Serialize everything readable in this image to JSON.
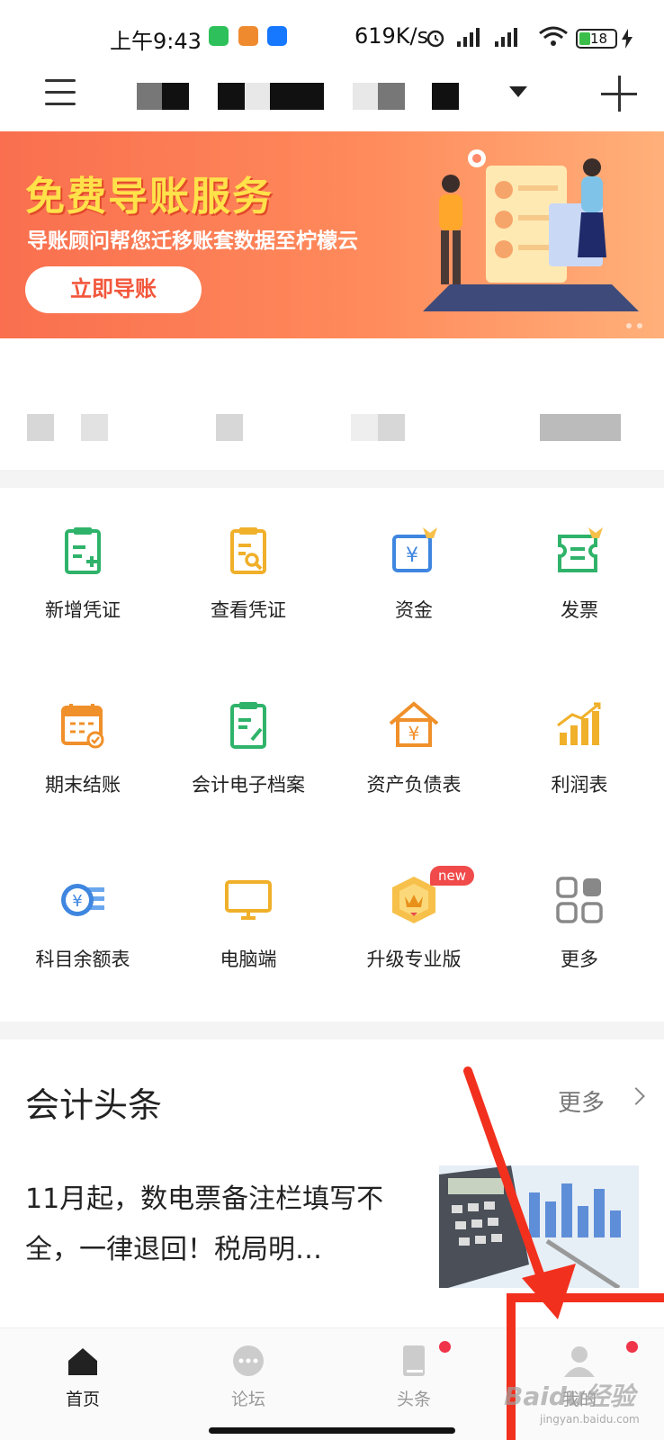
{
  "status_bar": {
    "time": "上午9:43",
    "net_speed": "619K/s",
    "battery": "18"
  },
  "nav": {
    "menu_icon": "menu-icon",
    "add_icon": "plus-icon",
    "org_name_redacted": true
  },
  "banner": {
    "title": "免费导账服务",
    "subtitle": "导账顾问帮您迁移账套数据至柠檬云",
    "button_label": "立即导账"
  },
  "grid": {
    "items": [
      {
        "label": "新增凭证",
        "icon": "add-voucher-icon"
      },
      {
        "label": "查看凭证",
        "icon": "view-voucher-icon"
      },
      {
        "label": "资金",
        "icon": "funds-icon"
      },
      {
        "label": "发票",
        "icon": "invoice-icon"
      },
      {
        "label": "期末结账",
        "icon": "period-close-icon"
      },
      {
        "label": "会计电子档案",
        "icon": "e-archive-icon"
      },
      {
        "label": "资产负债表",
        "icon": "balance-sheet-icon"
      },
      {
        "label": "利润表",
        "icon": "profit-chart-icon"
      },
      {
        "label": "科目余额表",
        "icon": "account-balance-icon"
      },
      {
        "label": "电脑端",
        "icon": "desktop-icon"
      },
      {
        "label": "升级专业版",
        "icon": "upgrade-icon"
      },
      {
        "label": "更多",
        "icon": "more-grid-icon"
      }
    ],
    "new_badge": "new"
  },
  "news": {
    "section_title": "会计头条",
    "more_label": "更多",
    "headline": "11月起，数电票备注栏填写不全，一律退回！税局明…"
  },
  "tabs": [
    {
      "label": "首页",
      "icon": "home-icon"
    },
    {
      "label": "论坛",
      "icon": "chat-icon"
    },
    {
      "label": "头条",
      "icon": "book-icon"
    },
    {
      "label": "我的",
      "icon": "user-icon"
    }
  ],
  "colors": {
    "banner_start": "#f96f4f",
    "banner_title": "#ffe14a",
    "green": "#2fb36a",
    "orange": "#f0902a",
    "blue": "#3f86e0",
    "annotation_red": "#f2301e"
  },
  "watermark": {
    "brand": "Baidu经验",
    "url": "jingyan.baidu.com"
  }
}
